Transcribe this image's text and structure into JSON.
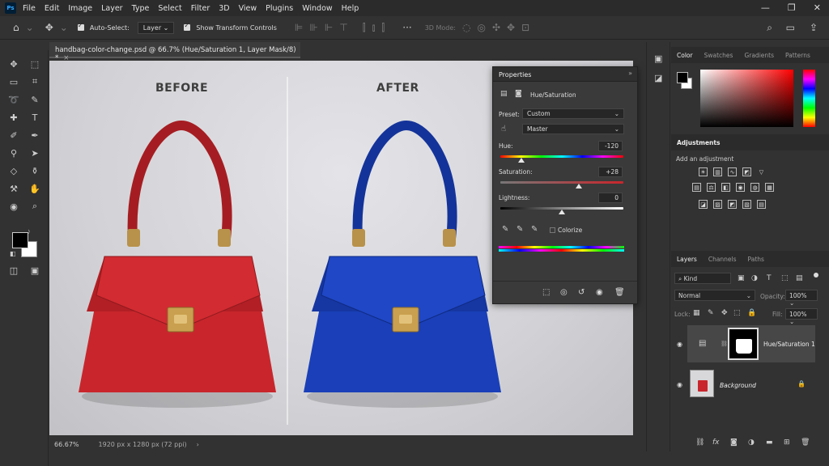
{
  "menu": {
    "logo": "Ps",
    "items": [
      "File",
      "Edit",
      "Image",
      "Layer",
      "Type",
      "Select",
      "Filter",
      "3D",
      "View",
      "Plugins",
      "Window",
      "Help"
    ],
    "window_controls": [
      "—",
      "❐",
      "✕"
    ]
  },
  "options": {
    "auto_select_label": "Auto-Select:",
    "auto_select_value": "Layer",
    "show_transform_label": "Show Transform Controls",
    "threed_mode_label": "3D Mode:"
  },
  "document": {
    "tab_title": "handbag-color-change.psd @ 66.7% (Hue/Saturation 1, Layer Mask/8) *",
    "before_label": "BEFORE",
    "after_label": "AFTER",
    "zoom": "66.67%",
    "dimensions": "1920 px x 1280 px (72 ppi)",
    "before_color": "#c8262c",
    "after_color": "#1a3fb8"
  },
  "properties": {
    "title": "Properties",
    "adjustment_name": "Hue/Saturation",
    "preset_label": "Preset:",
    "preset_value": "Custom",
    "channel_value": "Master",
    "hue_label": "Hue:",
    "hue_value": "-120",
    "saturation_label": "Saturation:",
    "saturation_value": "+28",
    "lightness_label": "Lightness:",
    "lightness_value": "0",
    "colorize_label": "Colorize",
    "hue_fraction": 0.17,
    "saturation_fraction": 0.64,
    "lightness_fraction": 0.5
  },
  "color_panel": {
    "tabs": [
      "Color",
      "Swatches",
      "Gradients",
      "Patterns"
    ],
    "active_tab": "Color"
  },
  "adjustments": {
    "title": "Adjustments",
    "subtitle": "Add an adjustment"
  },
  "layers_panel": {
    "tabs": [
      "Layers",
      "Channels",
      "Paths"
    ],
    "kind_label": "Kind",
    "blend_mode": "Normal",
    "opacity_label": "Opacity:",
    "opacity_value": "100%",
    "lock_label": "Lock:",
    "fill_label": "Fill:",
    "fill_value": "100%",
    "layers": [
      {
        "name": "Hue/Saturation 1"
      },
      {
        "name": "Background"
      }
    ]
  }
}
